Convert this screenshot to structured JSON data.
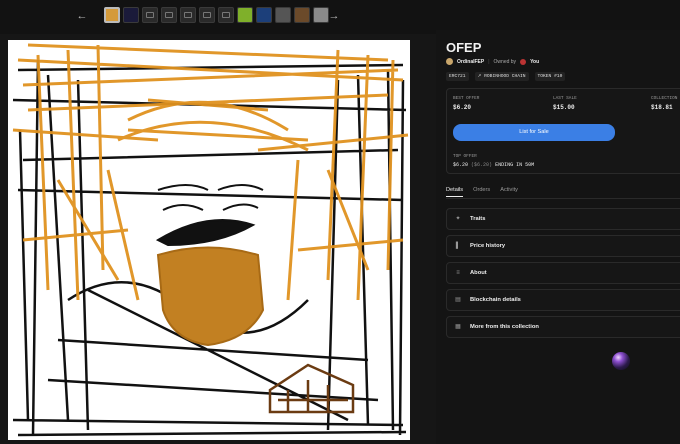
{
  "nav": {
    "back_icon": "arrow-left-icon",
    "forward_icon": "arrow-right-icon"
  },
  "thumbnails": [
    "thumb-1",
    "thumb-2",
    "thumb-3",
    "thumb-4",
    "thumb-5",
    "thumb-6",
    "thumb-7",
    "thumb-8",
    "thumb-9",
    "thumb-10",
    "thumb-11",
    "thumb-12"
  ],
  "item": {
    "title": "OFEP",
    "collection": "OrdinalFEP",
    "owned_by_label": "Owned by",
    "owner": "You",
    "tags": [
      "ERC721",
      "ROBINHOOD CHAIN",
      "TOKEN #10"
    ]
  },
  "stats": {
    "best_offer_label": "BEST OFFER",
    "best_offer": "$6.20",
    "last_sale_label": "LAST SALE",
    "last_sale": "$15.00",
    "collection_label": "COLLECTION",
    "collection_value": "$18.81"
  },
  "actions": {
    "list_for_sale": "List for Sale"
  },
  "top_offer": {
    "label": "TOP OFFER",
    "price": "$6.20",
    "price_sub": "($6.20)",
    "ending": "ENDING IN 50M"
  },
  "tabs": [
    "Details",
    "Orders",
    "Activity"
  ],
  "sections": [
    {
      "label": "Traits",
      "icon": "sparkle-icon"
    },
    {
      "label": "Price history",
      "icon": "bar-chart-icon"
    },
    {
      "label": "About",
      "icon": "info-icon"
    },
    {
      "label": "Blockchain details",
      "icon": "blockchain-icon"
    },
    {
      "label": "More from this collection",
      "icon": "grid-icon"
    }
  ],
  "colors": {
    "accent": "#3b7fe5",
    "background": "#121212",
    "panel": "#161616"
  }
}
